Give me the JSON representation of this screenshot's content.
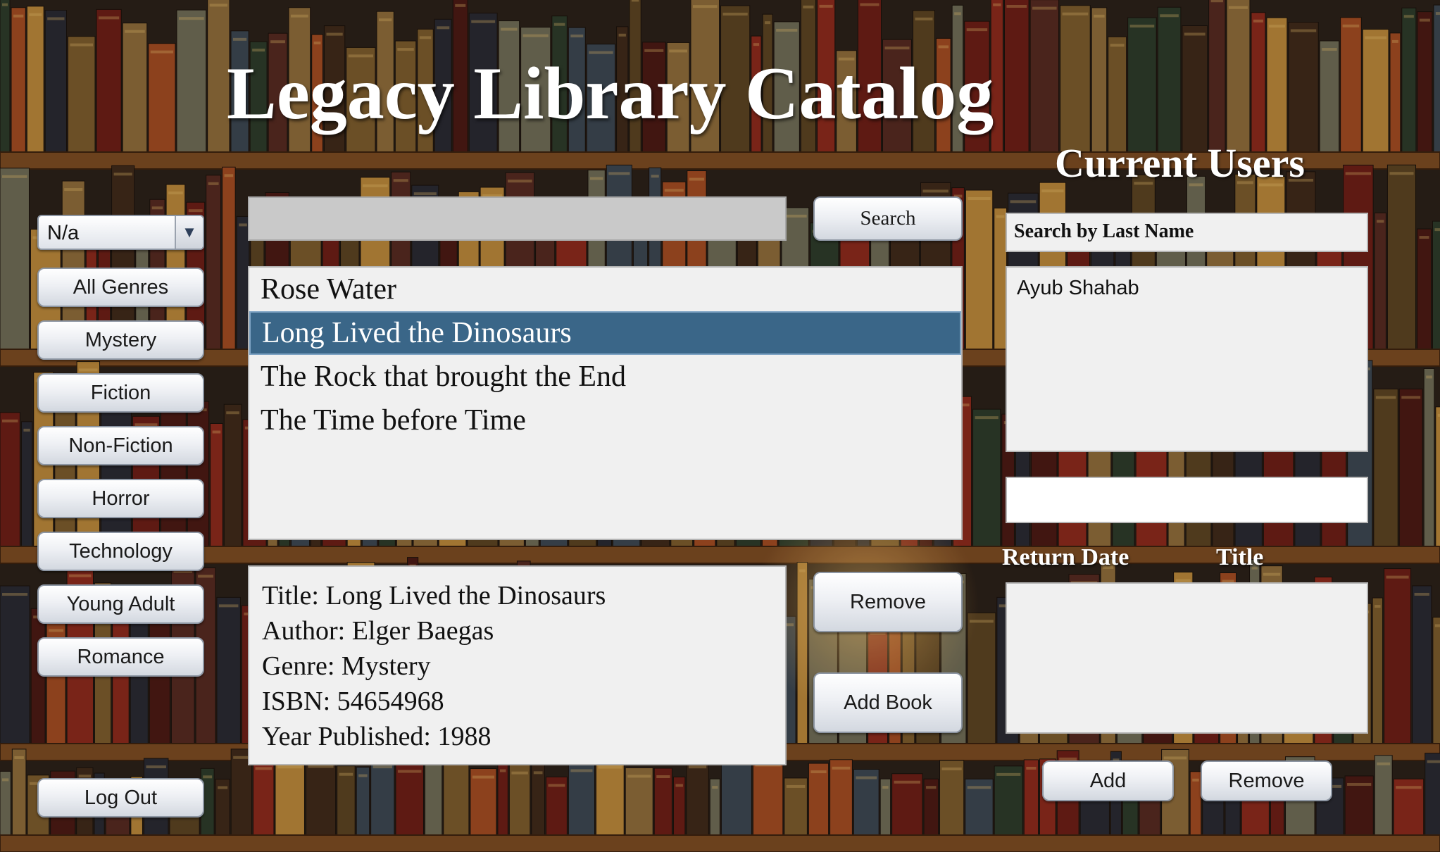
{
  "app": {
    "title": "Legacy Library Catalog"
  },
  "genre_filter": {
    "selected": "N/a",
    "buttons": [
      "All Genres",
      "Mystery",
      "Fiction",
      "Non-Fiction",
      "Horror",
      "Technology",
      "Young Adult",
      "Romance"
    ]
  },
  "logout_label": "Log Out",
  "search": {
    "value": "",
    "button_label": "Search"
  },
  "books": {
    "items": [
      "Rose Water",
      "Long Lived the Dinosaurs",
      "The Rock that brought the End",
      "The Time before Time"
    ],
    "selected_index": 1
  },
  "details": {
    "title": "Title: Long Lived the Dinosaurs",
    "author": "Author: Elger Baegas",
    "genre": "Genre: Mystery",
    "isbn": "ISBN: 54654968",
    "year": "Year Published: 1988"
  },
  "book_actions": {
    "remove_label": "Remove",
    "add_label": "Add Book"
  },
  "users": {
    "heading": "Current Users",
    "search_label": "Search by Last Name",
    "items": [
      "Ayub Shahab"
    ],
    "field_value": ""
  },
  "loans": {
    "col_return_date": "Return Date",
    "col_title": "Title",
    "rows": [],
    "add_label": "Add",
    "remove_label": "Remove"
  },
  "colors": {
    "selection": "#3a6688",
    "panel": "#f0f0f0",
    "search_field": "#c9c9c9"
  }
}
